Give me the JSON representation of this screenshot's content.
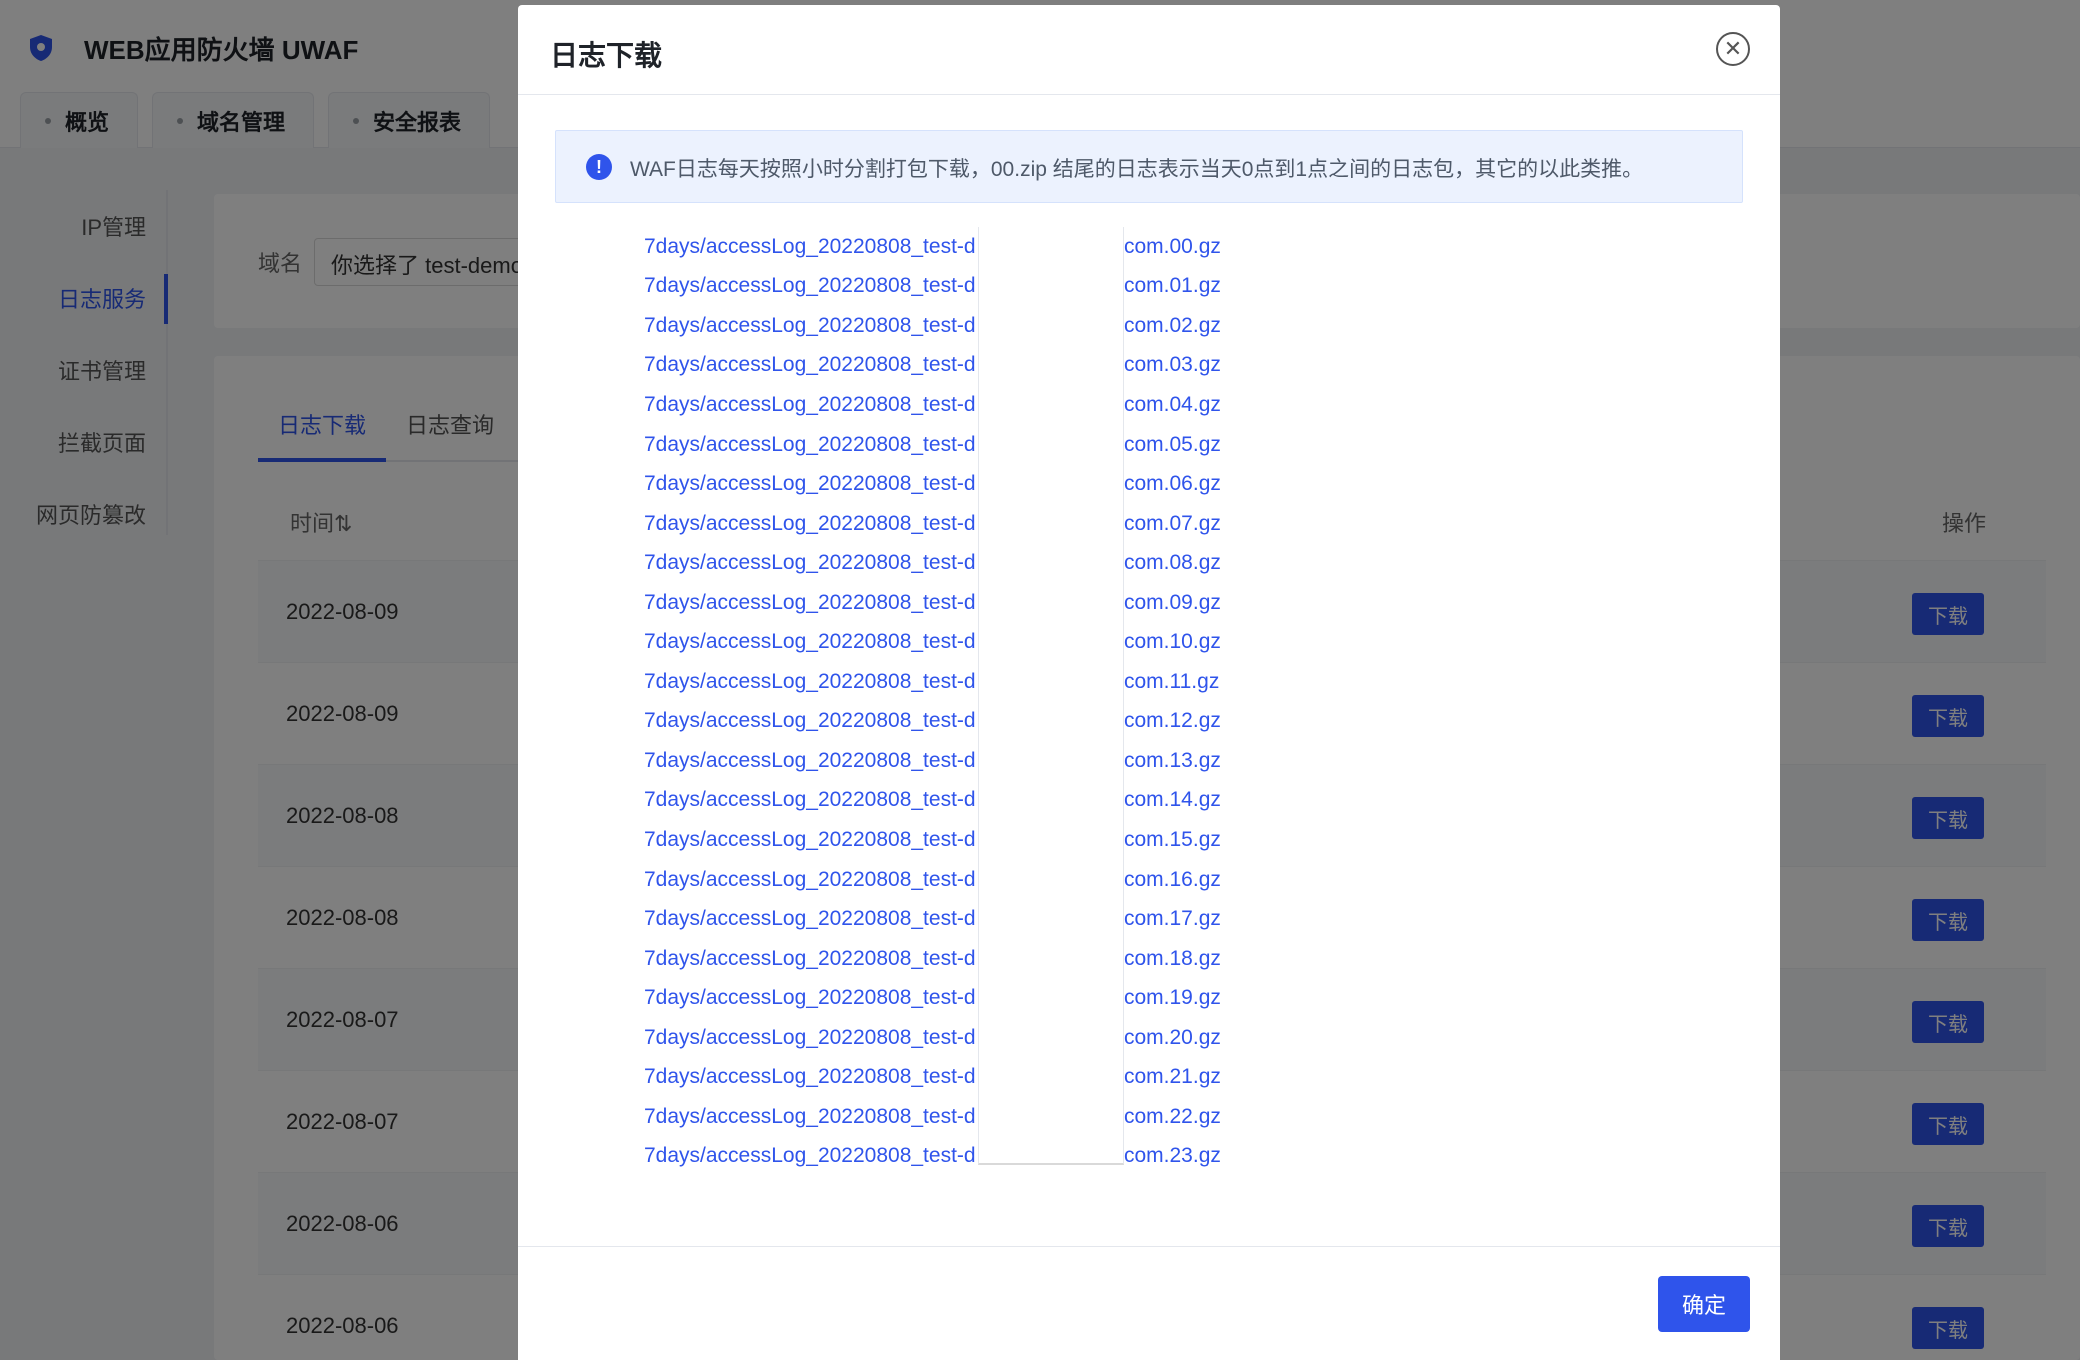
{
  "app": {
    "title": "WEB应用防火墙 UWAF",
    "top_tabs": [
      "概览",
      "域名管理",
      "安全报表"
    ],
    "side_nav": [
      {
        "label": "IP管理",
        "active": false
      },
      {
        "label": "日志服务",
        "active": true
      },
      {
        "label": "证书管理",
        "active": false
      },
      {
        "label": "拦截页面",
        "active": false
      },
      {
        "label": "网页防篡改",
        "active": false
      }
    ],
    "filter": {
      "label": "域名",
      "value": "你选择了 test-demo"
    },
    "inner_tabs": [
      {
        "label": "日志下载",
        "active": true
      },
      {
        "label": "日志查询",
        "active": false
      }
    ],
    "table": {
      "col_time": "时间⇅",
      "col_op": "操作",
      "download_label": "下载",
      "rows": [
        "2022-08-09",
        "2022-08-09",
        "2022-08-08",
        "2022-08-08",
        "2022-08-07",
        "2022-08-07",
        "2022-08-06",
        "2022-08-06"
      ]
    }
  },
  "modal": {
    "title": "日志下载",
    "close_icon": "close-circle-icon",
    "notice": "WAF日志每天按照小时分割打包下载，00.zip 结尾的日志表示当天0点到1点之间的日志包，其它的以此类推。",
    "files": [
      {
        "prefix": "7days/accessLog_20220808_test-d",
        "suffix": "com.00.gz"
      },
      {
        "prefix": "7days/accessLog_20220808_test-d",
        "suffix": "com.01.gz"
      },
      {
        "prefix": "7days/accessLog_20220808_test-d",
        "suffix": "com.02.gz"
      },
      {
        "prefix": "7days/accessLog_20220808_test-d",
        "suffix": "com.03.gz"
      },
      {
        "prefix": "7days/accessLog_20220808_test-d",
        "suffix": "com.04.gz"
      },
      {
        "prefix": "7days/accessLog_20220808_test-d",
        "suffix": "com.05.gz"
      },
      {
        "prefix": "7days/accessLog_20220808_test-d",
        "suffix": "com.06.gz"
      },
      {
        "prefix": "7days/accessLog_20220808_test-d",
        "suffix": "com.07.gz"
      },
      {
        "prefix": "7days/accessLog_20220808_test-d",
        "suffix": "com.08.gz"
      },
      {
        "prefix": "7days/accessLog_20220808_test-d",
        "suffix": "com.09.gz"
      },
      {
        "prefix": "7days/accessLog_20220808_test-d",
        "suffix": "com.10.gz"
      },
      {
        "prefix": "7days/accessLog_20220808_test-d",
        "suffix": "com.11.gz"
      },
      {
        "prefix": "7days/accessLog_20220808_test-d",
        "suffix": "com.12.gz"
      },
      {
        "prefix": "7days/accessLog_20220808_test-d",
        "suffix": "com.13.gz"
      },
      {
        "prefix": "7days/accessLog_20220808_test-d",
        "suffix": "com.14.gz"
      },
      {
        "prefix": "7days/accessLog_20220808_test-d",
        "suffix": "com.15.gz"
      },
      {
        "prefix": "7days/accessLog_20220808_test-d",
        "suffix": "com.16.gz"
      },
      {
        "prefix": "7days/accessLog_20220808_test-d",
        "suffix": "com.17.gz"
      },
      {
        "prefix": "7days/accessLog_20220808_test-d",
        "suffix": "com.18.gz"
      },
      {
        "prefix": "7days/accessLog_20220808_test-d",
        "suffix": "com.19.gz"
      },
      {
        "prefix": "7days/accessLog_20220808_test-d",
        "suffix": "com.20.gz"
      },
      {
        "prefix": "7days/accessLog_20220808_test-d",
        "suffix": "com.21.gz"
      },
      {
        "prefix": "7days/accessLog_20220808_test-d",
        "suffix": "com.22.gz"
      },
      {
        "prefix": "7days/accessLog_20220808_test-d",
        "suffix": "com.23.gz"
      }
    ],
    "ok_label": "确定"
  },
  "colors": {
    "primary": "#2f54eb",
    "overlay": "rgba(0,0,0,0.5)",
    "notice_bg": "#ecf2fe"
  }
}
